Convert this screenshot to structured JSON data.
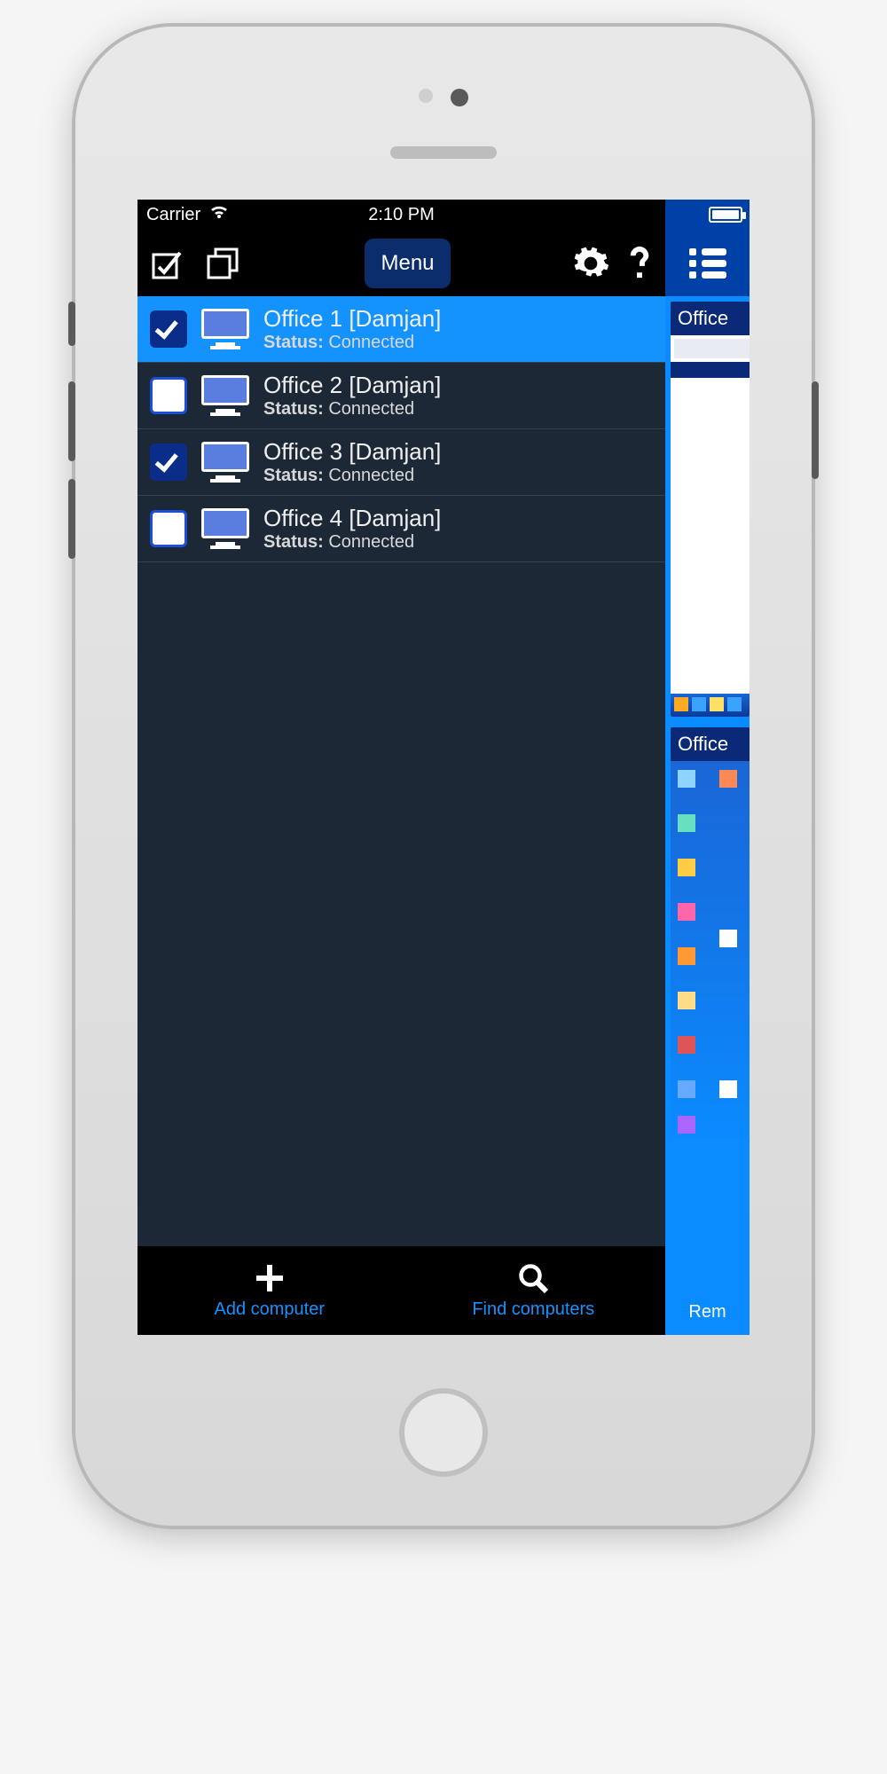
{
  "statusbar": {
    "carrier": "Carrier",
    "time": "2:10 PM"
  },
  "toolbar": {
    "menu_label": "Menu"
  },
  "computers": [
    {
      "name": "Office 1 [Damjan]",
      "status_label": "Status:",
      "status_value": "Connected",
      "selected": true,
      "checked": true
    },
    {
      "name": "Office 2 [Damjan]",
      "status_label": "Status:",
      "status_value": "Connected",
      "selected": false,
      "checked": false
    },
    {
      "name": "Office 3 [Damjan]",
      "status_label": "Status:",
      "status_value": "Connected",
      "selected": false,
      "checked": true
    },
    {
      "name": "Office 4 [Damjan]",
      "status_label": "Status:",
      "status_value": "Connected",
      "selected": false,
      "checked": false
    }
  ],
  "bottombar": {
    "add_label": "Add computer",
    "find_label": "Find computers"
  },
  "right_panel": {
    "thumb1_title": "Office",
    "thumb2_title": "Office",
    "bottom_label": "Rem"
  }
}
